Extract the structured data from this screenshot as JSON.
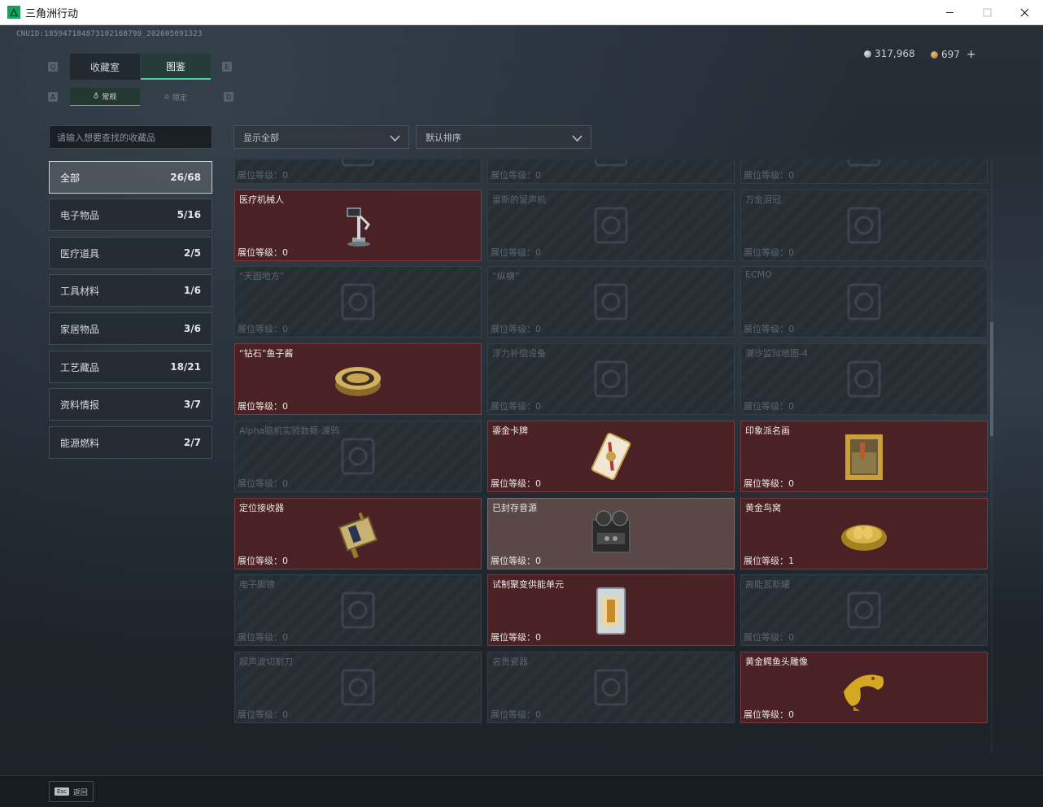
{
  "window": {
    "title": "三角洲行动",
    "minimize": "minimize",
    "maximize": "maximize",
    "close": "close"
  },
  "header": {
    "uid": "CNUID:185947184873102168798_202605091323",
    "currency_silver": "317,968",
    "currency_gold": "697",
    "currency_add": "+"
  },
  "tabs": {
    "main": [
      {
        "label": "收藏室",
        "active": false
      },
      {
        "label": "图鉴",
        "active": true
      }
    ],
    "sub": [
      {
        "label": "常规",
        "active": true
      },
      {
        "label": "限定",
        "active": false
      }
    ],
    "key_left": "Q",
    "key_right": "E",
    "key_sub_left": "A",
    "key_sub_right": "D"
  },
  "search": {
    "placeholder": "请输入想要查找的收藏品"
  },
  "filters": {
    "show": "显示全部",
    "sort": "默认排序"
  },
  "categories": [
    {
      "label": "全部",
      "count": "26/68",
      "active": true
    },
    {
      "label": "电子物品",
      "count": "5/16",
      "active": false
    },
    {
      "label": "医疗道具",
      "count": "2/5",
      "active": false
    },
    {
      "label": "工具材料",
      "count": "1/6",
      "active": false
    },
    {
      "label": "家居物品",
      "count": "3/6",
      "active": false
    },
    {
      "label": "工艺藏品",
      "count": "18/21",
      "active": false
    },
    {
      "label": "资料情报",
      "count": "3/7",
      "active": false
    },
    {
      "label": "能源燃料",
      "count": "2/7",
      "active": false
    }
  ],
  "level_label": "展位等级：",
  "items": [
    {
      "name": "",
      "level": "0",
      "state": "dim",
      "icon": "machine-icon"
    },
    {
      "name": "",
      "level": "0",
      "state": "dim",
      "icon": "device-icon"
    },
    {
      "name": "",
      "level": "0",
      "state": "dim",
      "icon": "device-icon"
    },
    {
      "name": "医疗机械人",
      "level": "0",
      "state": "owned",
      "icon": "robot-arm-icon"
    },
    {
      "name": "雷斯的留声机",
      "level": "0",
      "state": "dim",
      "icon": "gramophone-icon"
    },
    {
      "name": "万金泪冠",
      "level": "0",
      "state": "dim",
      "icon": "crown-icon"
    },
    {
      "name": "“天圆地方”",
      "level": "0",
      "state": "dim",
      "icon": "globe-icon"
    },
    {
      "name": "“纵横”",
      "level": "0",
      "state": "dim",
      "icon": "board-icon"
    },
    {
      "name": "ECMO",
      "level": "0",
      "state": "dim",
      "icon": "ecmo-icon"
    },
    {
      "name": "“钻石”鱼子酱",
      "level": "0",
      "state": "owned",
      "icon": "caviar-tin-icon"
    },
    {
      "name": "浮力补偿设备",
      "level": "0",
      "state": "dim",
      "icon": "vest-icon"
    },
    {
      "name": "潮汐监狱地图-4",
      "level": "0",
      "state": "dim",
      "icon": "map-icon"
    },
    {
      "name": "Alpha脑机实验数据-渡鸦",
      "level": "0",
      "state": "dim",
      "icon": "drive-icon"
    },
    {
      "name": "鎏金卡牌",
      "level": "0",
      "state": "owned",
      "icon": "card-icon"
    },
    {
      "name": "印象派名画",
      "level": "0",
      "state": "owned",
      "icon": "painting-icon"
    },
    {
      "name": "定位接收器",
      "level": "0",
      "state": "owned",
      "icon": "receiver-icon"
    },
    {
      "name": "已封存音源",
      "level": "0",
      "state": "owned-light",
      "icon": "tape-recorder-icon"
    },
    {
      "name": "黄金鸟窝",
      "level": "1",
      "state": "owned",
      "icon": "gold-nest-icon"
    },
    {
      "name": "电子脚镣",
      "level": "0",
      "state": "dim",
      "icon": "shackle-icon"
    },
    {
      "name": "试制聚变供能单元",
      "level": "0",
      "state": "owned",
      "icon": "fusion-cell-icon"
    },
    {
      "name": "高能瓦斯罐",
      "level": "0",
      "state": "dim",
      "icon": "gas-tank-icon"
    },
    {
      "name": "超声波切割刀",
      "level": "0",
      "state": "dim",
      "icon": "cutter-icon"
    },
    {
      "name": "名贵瓷器",
      "level": "0",
      "state": "dim",
      "icon": "vase-icon"
    },
    {
      "name": "黄金鳄鱼头雕像",
      "level": "0",
      "state": "owned",
      "icon": "gold-crocodile-icon"
    }
  ],
  "bottom": {
    "esc_key": "Esc",
    "back": "返回"
  }
}
